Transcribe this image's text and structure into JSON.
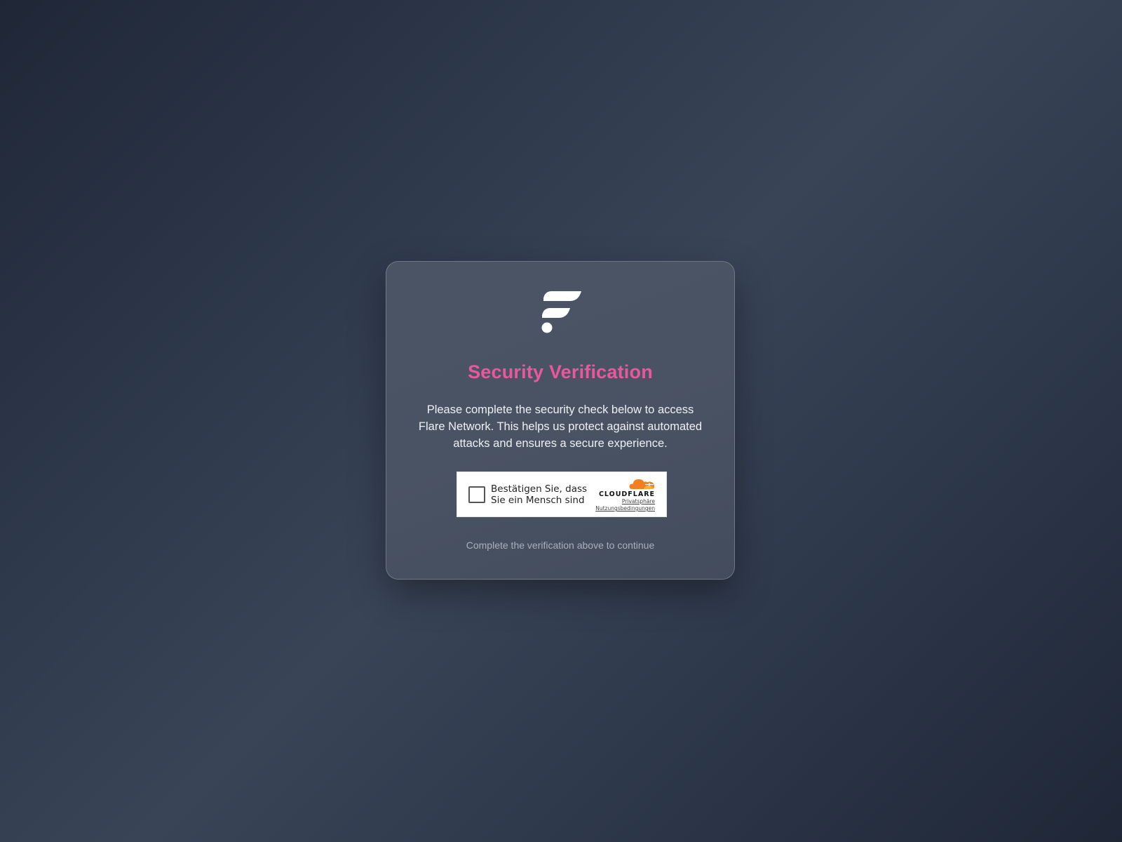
{
  "card": {
    "title": "Security Verification",
    "description": "Please complete the security check below to access Flare Network. This helps us protect against automated attacks and ensures a secure experience.",
    "footnote": "Complete the verification above to continue"
  },
  "turnstile": {
    "checkbox_label": "Bestätigen Sie, dass Sie ein Mensch sind",
    "brand": "CLOUDFLARE",
    "privacy_link": "Privatsphäre",
    "terms_link": "Nutzungsbedingungen"
  },
  "colors": {
    "title": "#e8589b",
    "cloudflare_orange": "#f38020"
  },
  "icons": {
    "logo": "flare-logo-icon",
    "cloud": "cloudflare-cloud-icon"
  }
}
